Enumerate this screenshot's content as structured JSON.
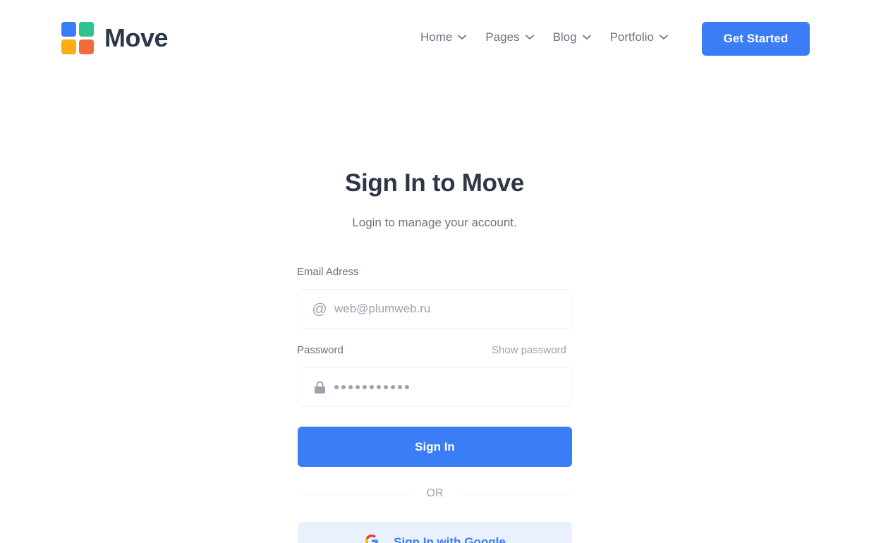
{
  "brand": {
    "name": "Move",
    "tiles": [
      "#3b7cf7",
      "#2fc38c",
      "#fbad15",
      "#f26b3a"
    ]
  },
  "nav": {
    "items": [
      {
        "label": "Home",
        "icon": "chevron-down-icon"
      },
      {
        "label": "Pages",
        "icon": "chevron-down-icon"
      },
      {
        "label": "Blog",
        "icon": "chevron-down-icon"
      },
      {
        "label": "Portfolio",
        "icon": "chevron-down-icon"
      }
    ],
    "cta_label": "Get Started"
  },
  "form": {
    "title": "Sign In to Move",
    "subtitle": "Login to manage your account.",
    "email": {
      "label": "Email Adress",
      "placeholder": "web@plumweb.ru",
      "value": "",
      "icon": "at-icon"
    },
    "password": {
      "label": "Password",
      "show_label": "Show password",
      "masked_length": 11,
      "icon": "lock-icon"
    },
    "submit_label": "Sign In",
    "divider_label": "OR",
    "google_label": "Sign In with Google"
  },
  "colors": {
    "accent": "#3b7cf7",
    "text_dark": "#2d3748",
    "text_muted": "#6b7280",
    "google_bg": "#e8f1fd"
  }
}
